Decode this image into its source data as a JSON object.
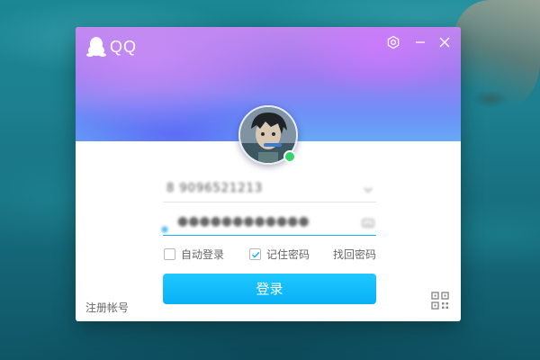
{
  "app": {
    "brand_text": "QQ"
  },
  "header": {
    "icons": [
      "penguin-logo-icon",
      "settings-icon",
      "minimize-icon",
      "close-icon"
    ]
  },
  "login": {
    "account_value": "8 9096521213",
    "password_value": "●●●●●●●●●●●●",
    "auto_login_label": "自动登录",
    "auto_login_checked": false,
    "remember_password_label": "记住密码",
    "remember_password_checked": true,
    "find_password_label": "找回密码",
    "login_button_label": "登录",
    "register_label": "注册帐号"
  },
  "status": {
    "online": true
  },
  "colors": {
    "accent": "#12b7f5",
    "online": "#2fd76a",
    "header_purple": "#b07ff0",
    "header_blue": "#66a9f6"
  }
}
